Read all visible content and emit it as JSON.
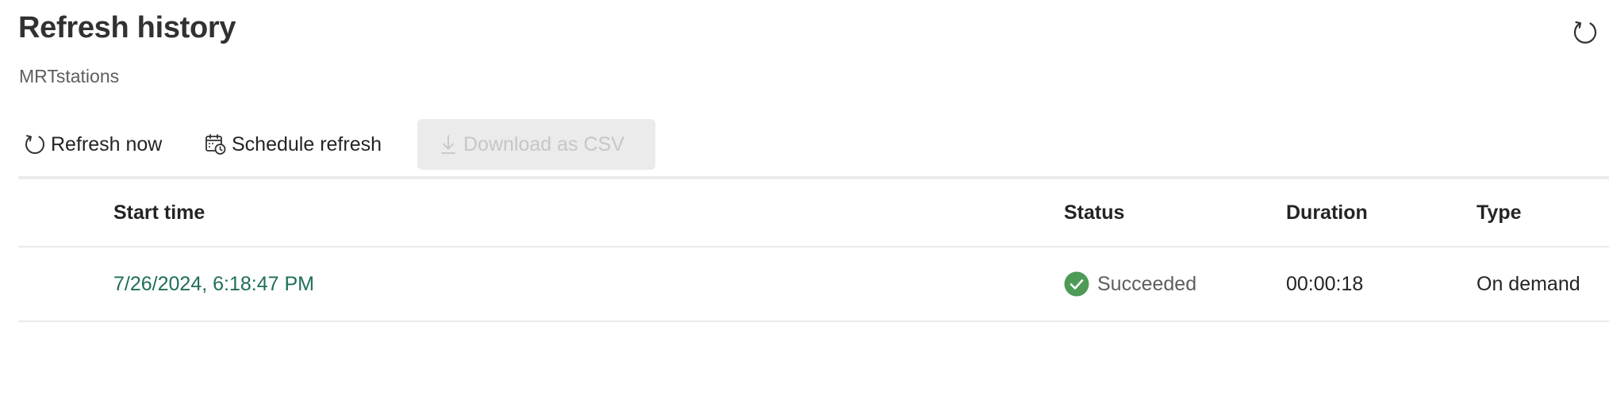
{
  "header": {
    "title": "Refresh history",
    "subtitle": "MRTstations",
    "refresh_icon": "refresh-icon"
  },
  "toolbar": {
    "refresh_now": {
      "label": "Refresh now",
      "icon": "refresh-icon"
    },
    "schedule_refresh": {
      "label": "Schedule refresh",
      "icon": "calendar-clock-icon"
    },
    "download_csv": {
      "label": "Download as CSV",
      "icon": "download-icon",
      "disabled": true
    }
  },
  "table": {
    "columns": [
      "Start time",
      "Status",
      "Duration",
      "Type"
    ],
    "rows": [
      {
        "start_time": "7/26/2024, 6:18:47 PM",
        "status": "Succeeded",
        "status_icon": "success-check-icon",
        "duration": "00:00:18",
        "type": "On demand"
      }
    ]
  },
  "colors": {
    "link": "#1f6e5a",
    "success": "#4e9a57",
    "disabled_bg": "#ebebeb",
    "disabled_text": "#c8c6c4"
  }
}
